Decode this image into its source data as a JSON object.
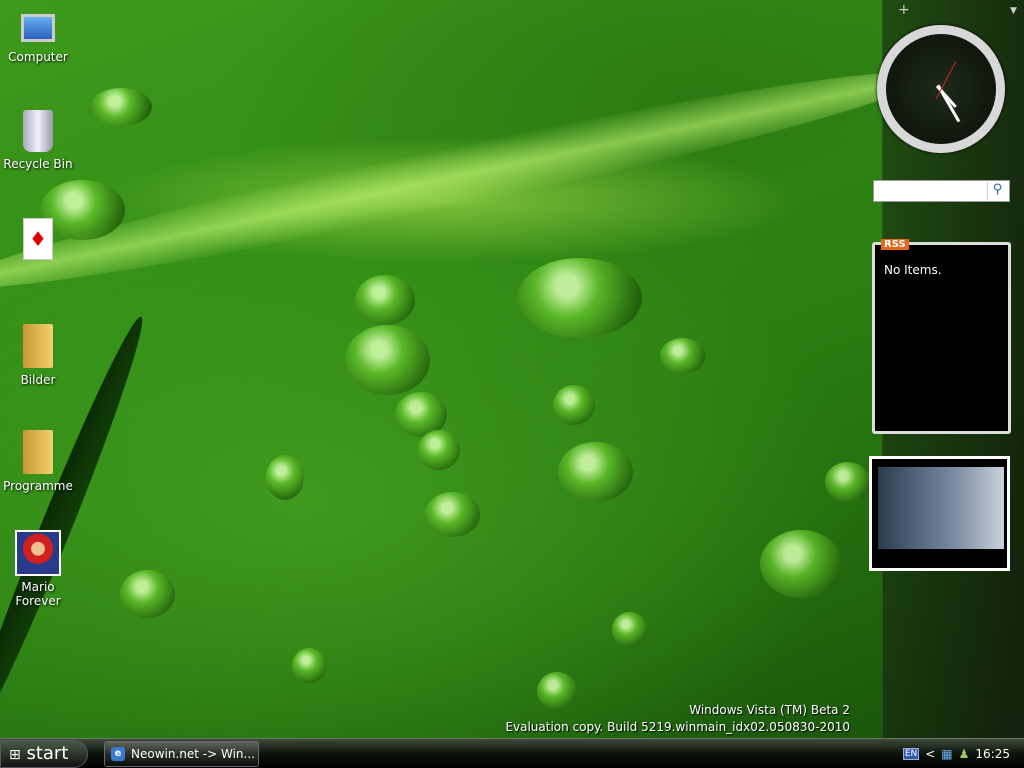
{
  "desktop": {
    "icons": [
      {
        "label": "Computer",
        "icon": "computer-icon"
      },
      {
        "label": "Recycle Bin",
        "icon": "recycle-bin-icon"
      },
      {
        "label": "",
        "icon": "solitaire-cards-icon"
      },
      {
        "label": "Bilder",
        "icon": "folder-icon"
      },
      {
        "label": "Programme",
        "icon": "folder-icon"
      },
      {
        "label": "Mario Forever",
        "icon": "mario-icon"
      }
    ],
    "watermark": {
      "line1": "Windows Vista (TM) Beta 2",
      "line2": "Evaluation copy. Build 5219.winmain_idx02.050830-2010"
    }
  },
  "sidebar": {
    "add_label": "+",
    "search_placeholder": "",
    "rss": {
      "badge": "RSS",
      "message": "No Items."
    }
  },
  "taskbar": {
    "start_label": "start",
    "tasks": [
      {
        "label": "Neowin.net -> Win...",
        "icon": "internet-explorer-icon"
      }
    ],
    "tray": {
      "language": "EN",
      "clock": "16:25",
      "chevron": "<"
    }
  }
}
